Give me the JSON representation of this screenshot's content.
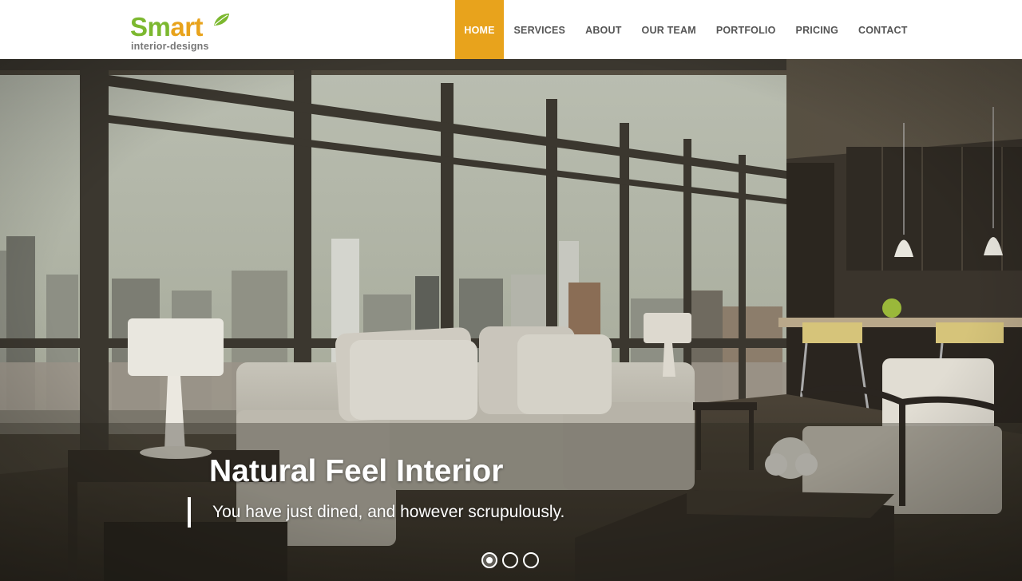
{
  "brand": {
    "name_part1": "Sm",
    "name_part2": "art",
    "tagline": "interior-designs",
    "green": "#7cb82f",
    "orange": "#e8a31c"
  },
  "nav": {
    "items": [
      {
        "label": "HOME",
        "active": true
      },
      {
        "label": "SERVICES",
        "active": false
      },
      {
        "label": "ABOUT",
        "active": false
      },
      {
        "label": "OUR TEAM",
        "active": false
      },
      {
        "label": "PORTFOLIO",
        "active": false
      },
      {
        "label": "PRICING",
        "active": false
      },
      {
        "label": "CONTACT",
        "active": false
      }
    ],
    "active_color": "#e8a31c"
  },
  "hero": {
    "title": "Natural Feel Interior",
    "subtitle": "You have just dined, and however scrupulously.",
    "slides": [
      {
        "active": true
      },
      {
        "active": false
      },
      {
        "active": false
      }
    ]
  }
}
